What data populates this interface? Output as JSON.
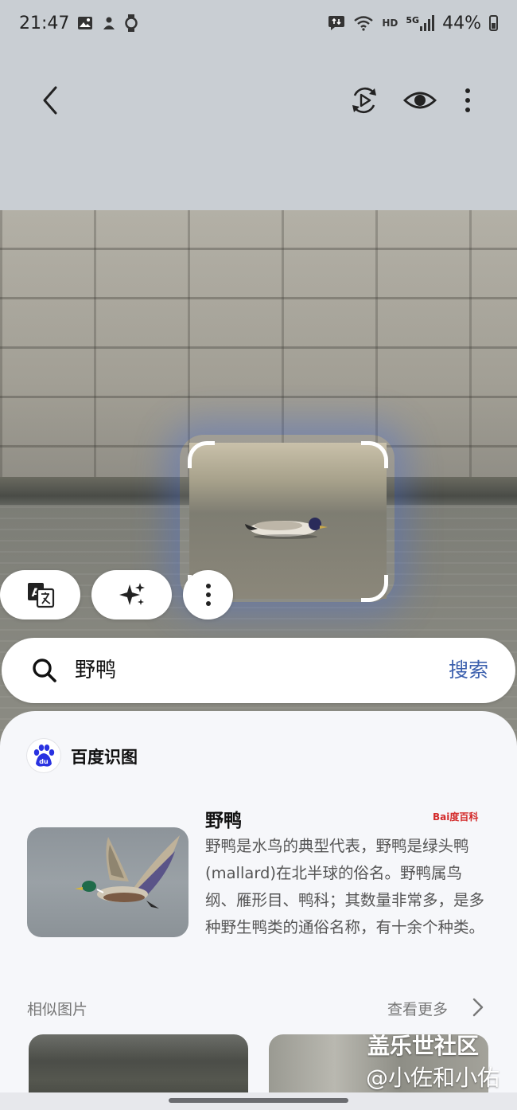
{
  "status_bar": {
    "time": "21:47",
    "left_icons": [
      "gallery-icon",
      "person-icon",
      "watch-icon"
    ],
    "right_icons": [
      "transfer-icon",
      "wifi-icon",
      "hd-icon",
      "signal-5g-icon",
      "battery-icon"
    ],
    "hd_label": "HD",
    "network_label": "5G",
    "battery": "44%"
  },
  "toolbar": {
    "actions": [
      "back-icon",
      "remaster-icon",
      "eye-icon",
      "more-vert-icon"
    ]
  },
  "chips": [
    "translate-icon",
    "ai-sparkle-icon",
    "more-vert-icon"
  ],
  "search": {
    "query": "野鸭",
    "button_label": "搜索"
  },
  "result": {
    "provider": "百度识图",
    "title": "野鸭",
    "source_logo_text": "Bai度百科",
    "description": "野鸭是水鸟的典型代表，野鸭是绿头鸭(mallard)在北半球的俗名。野鸭属鸟纲、雁形目、鸭科；其数量非常多，是多种野生鸭类的通俗名称，有十余个种类。野鸭能进行…",
    "similar_label": "相似图片",
    "see_more_label": "查看更多"
  },
  "watermark": {
    "line1": "盖乐世社区",
    "line2": "@小佐和小佑"
  },
  "colors": {
    "accent_blue": "#3b5fad",
    "top_bar_bg": "#c9ced3",
    "sheet_bg": "#f6f7fa"
  }
}
